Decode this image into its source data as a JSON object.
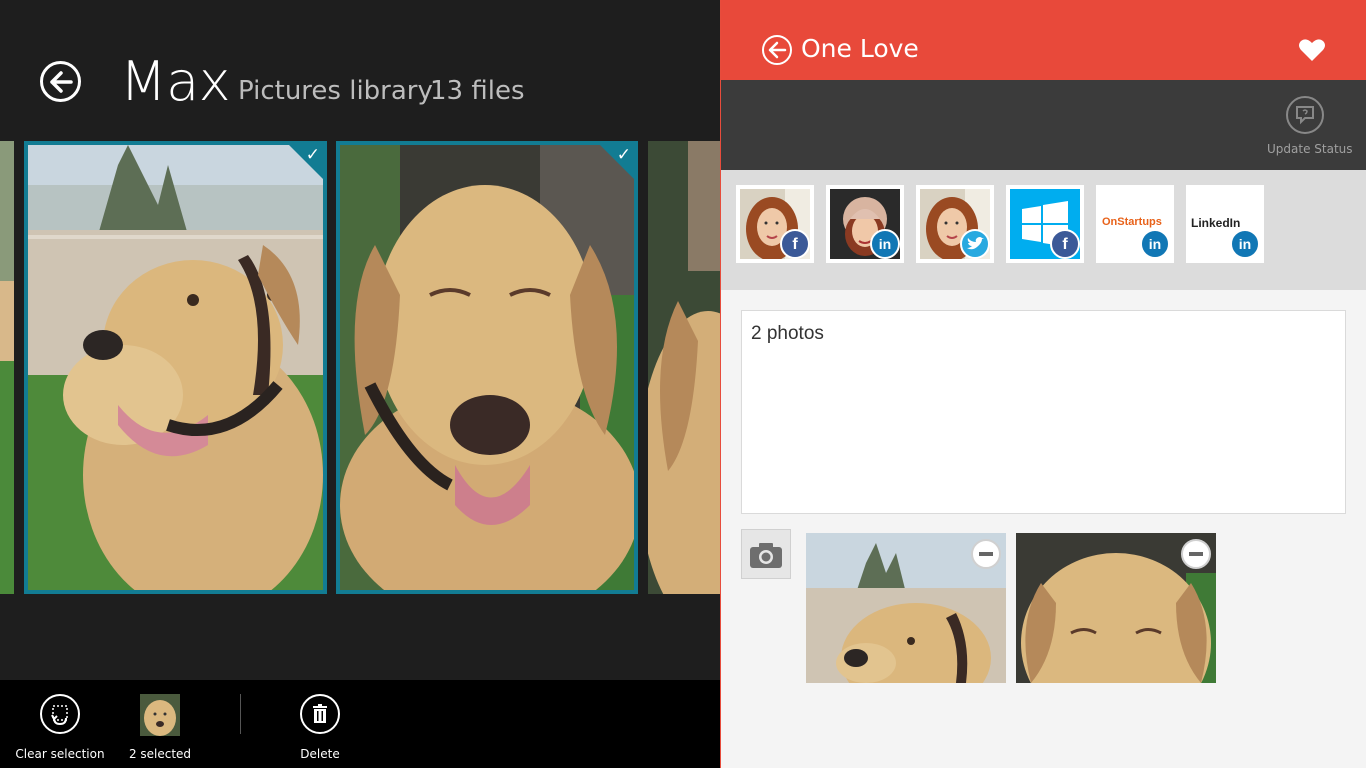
{
  "gallery": {
    "title": "Max",
    "location": "Pictures library",
    "file_count": "13 files",
    "selected_count": 2
  },
  "appbar": {
    "clear_label": "Clear selection",
    "selected_label": "2 selected",
    "delete_label": "Delete"
  },
  "share_panel": {
    "title": "One Love",
    "update_status_label": "Update Status",
    "accounts": [
      {
        "name": "facebook-account",
        "network": "facebook"
      },
      {
        "name": "linkedin-account",
        "network": "linkedin"
      },
      {
        "name": "twitter-account",
        "network": "twitter"
      },
      {
        "name": "windows-facebook-page",
        "network": "facebook"
      },
      {
        "name": "onstartups-linkedin-group",
        "network": "linkedin"
      },
      {
        "name": "linkedin-group",
        "network": "linkedin"
      }
    ],
    "account_logos": {
      "onstartups": "OnStartups",
      "linkedin": "LinkedIn"
    },
    "status_text": "2 photos",
    "attachments_count": 2
  },
  "colors": {
    "accent_red": "#e8493a",
    "selection_teal": "#127c93",
    "facebook": "#3b5998",
    "linkedin": "#1177b5",
    "twitter": "#28a9e0"
  },
  "icons": {
    "back": "back-arrow-icon",
    "heart": "heart-icon",
    "update_status": "speech-bubble-icon",
    "camera": "camera-icon",
    "remove": "minus-icon",
    "delete": "trash-icon",
    "clear": "clear-selection-icon"
  }
}
